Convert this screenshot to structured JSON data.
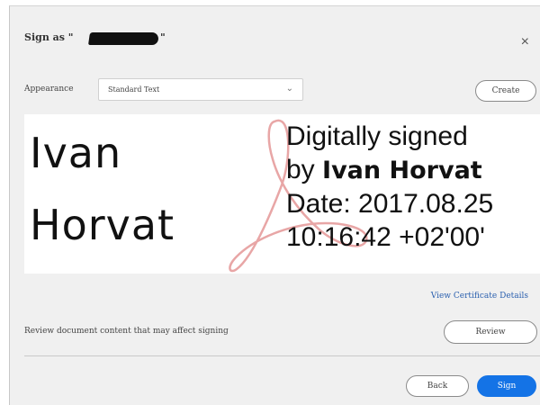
{
  "dialog": {
    "title_prefix": "Sign as \"",
    "title_suffix": "\"",
    "close_glyph": "×"
  },
  "appearance": {
    "label": "Appearance",
    "selected": "Standard Text",
    "chevron_glyph": "⌄",
    "create_label": "Create"
  },
  "preview": {
    "name_line1": "Ivan",
    "name_line2": "Horvat",
    "detail_line1": "Digitally signed",
    "detail_line2_prefix": "by ",
    "detail_line2_name": "Ivan Horvat",
    "detail_line3": "Date: 2017.08.25",
    "detail_line4": "10:16:42 +02'00'",
    "watermark_icon": "adobe-acrobat-icon",
    "watermark_color": "#e8a6a6"
  },
  "links": {
    "certificate": "View Certificate Details"
  },
  "review": {
    "text": "Review document content that may affect signing",
    "button_label": "Review"
  },
  "footer": {
    "back_label": "Back",
    "sign_label": "Sign"
  },
  "colors": {
    "accent": "#1473e6",
    "link": "#2a5fae",
    "dialog_bg": "#f0f0f0"
  }
}
